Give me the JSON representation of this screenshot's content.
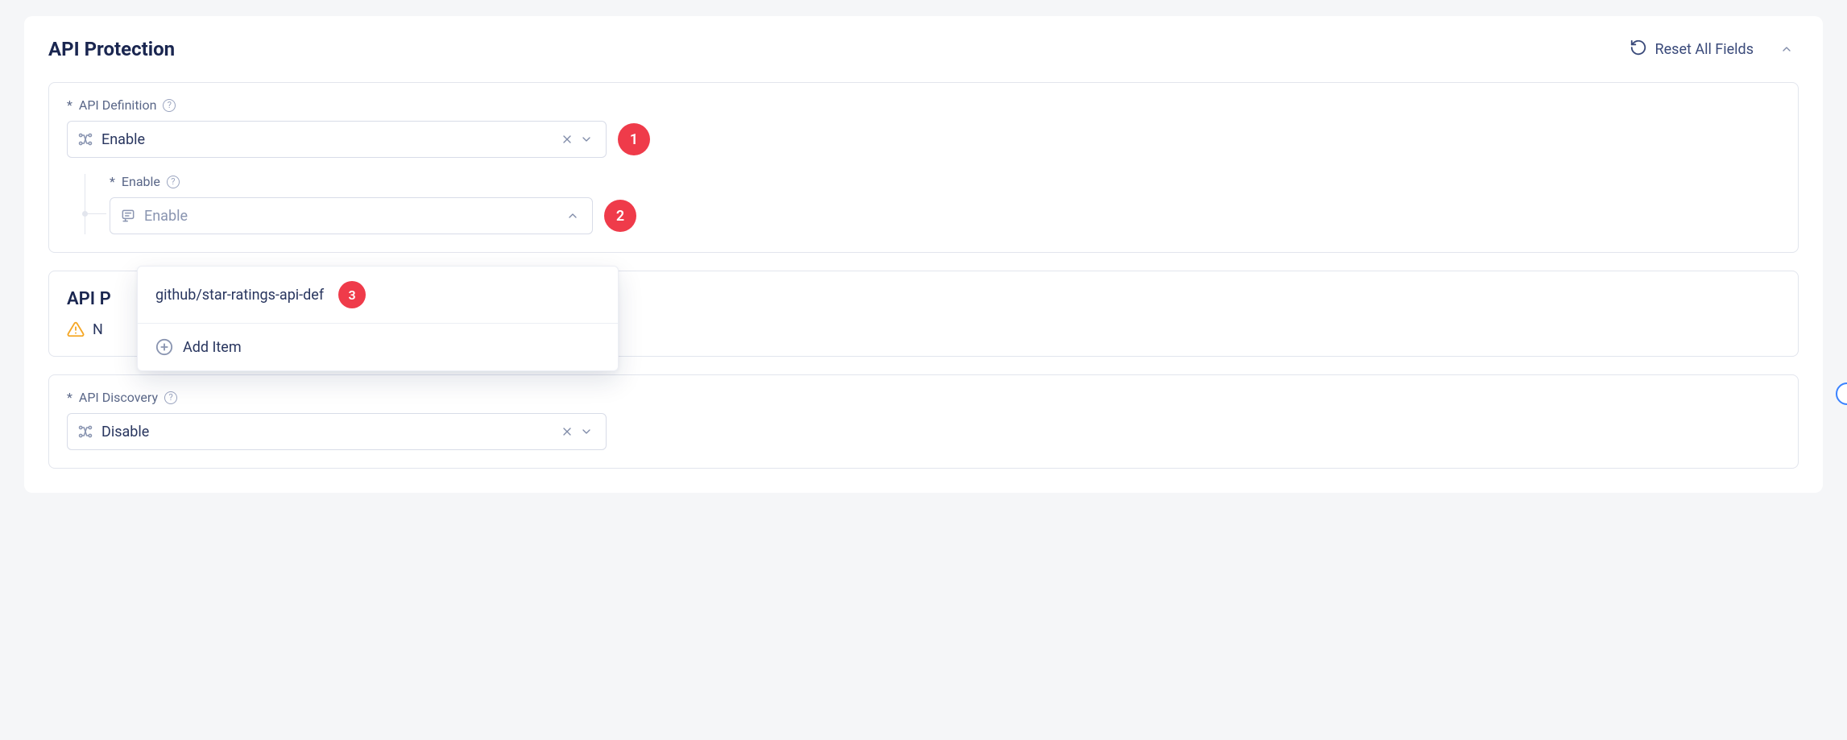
{
  "header": {
    "title": "API Protection",
    "reset_label": "Reset All Fields"
  },
  "badges": {
    "b1": "1",
    "b2": "2",
    "b3": "3"
  },
  "api_definition": {
    "label": "API Definition",
    "value": "Enable",
    "enable_sub": {
      "label": "Enable",
      "placeholder": "Enable"
    }
  },
  "dropdown": {
    "option1": "github/star-ratings-api-def",
    "add_item": "Add Item"
  },
  "api_rules_panel": {
    "title_visible": "API P",
    "notice_visible": "N"
  },
  "api_discovery": {
    "label": "API Discovery",
    "value": "Disable"
  }
}
